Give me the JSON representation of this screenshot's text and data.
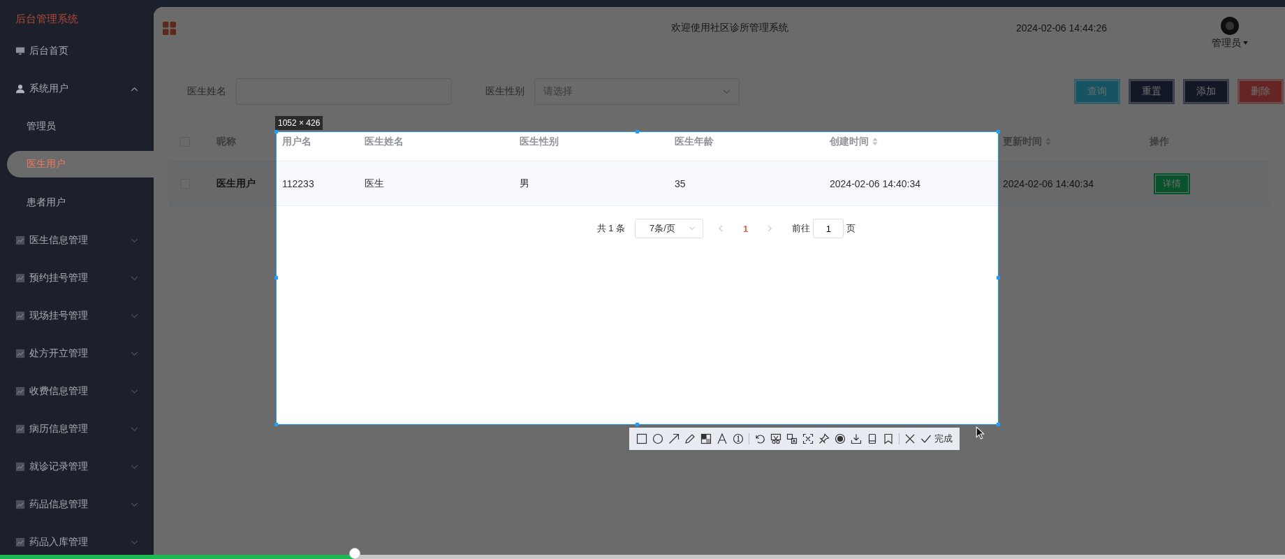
{
  "sidebar": {
    "title": "后台管理系统",
    "items": [
      {
        "label": "后台首页",
        "kind": "monitor",
        "selected": false
      },
      {
        "label": "系统用户",
        "kind": "user",
        "selected": false,
        "expanded": true,
        "children": [
          {
            "label": "管理员",
            "selected": false
          },
          {
            "label": "医生用户",
            "selected": true
          },
          {
            "label": "患者用户",
            "selected": false
          }
        ]
      },
      {
        "label": "医生信息管理",
        "kind": "chart",
        "selected": false,
        "expanded": false
      },
      {
        "label": "预约挂号管理",
        "kind": "chart",
        "selected": false,
        "expanded": false
      },
      {
        "label": "现场挂号管理",
        "kind": "chart",
        "selected": false,
        "expanded": false
      },
      {
        "label": "处方开立管理",
        "kind": "chart",
        "selected": false,
        "expanded": false
      },
      {
        "label": "收费信息管理",
        "kind": "chart",
        "selected": false,
        "expanded": false
      },
      {
        "label": "病历信息管理",
        "kind": "chart",
        "selected": false,
        "expanded": false
      },
      {
        "label": "就诊记录管理",
        "kind": "chart",
        "selected": false,
        "expanded": false
      },
      {
        "label": "药品信息管理",
        "kind": "chart",
        "selected": false,
        "expanded": false
      },
      {
        "label": "药品入库管理",
        "kind": "chart",
        "selected": false,
        "expanded": false
      }
    ]
  },
  "header": {
    "title": "欢迎使用社区诊所管理系统",
    "datetime": "2024-02-06 14:44:26",
    "user": "管理员"
  },
  "search": {
    "fields": [
      {
        "label": "医生姓名",
        "kind": "text"
      },
      {
        "label": "医生性别",
        "kind": "select",
        "placeholder": "请选择"
      }
    ],
    "buttons": [
      {
        "label": "查询",
        "kind": "query"
      },
      {
        "label": "重置",
        "kind": "reset"
      },
      {
        "label": "添加",
        "kind": "add"
      },
      {
        "label": "删除",
        "kind": "delete"
      }
    ]
  },
  "table": {
    "all_checked": false,
    "columns": [
      {
        "label": "昵称",
        "sortable": false
      },
      {
        "label": "用户名",
        "sortable": false
      },
      {
        "label": "医生姓名",
        "sortable": false
      },
      {
        "label": "医生性别",
        "sortable": false
      },
      {
        "label": "医生年龄",
        "sortable": false
      },
      {
        "label": "创建时间",
        "sortable": true
      },
      {
        "label": "更新时间",
        "sortable": true
      },
      {
        "label": "操作",
        "sortable": false
      }
    ],
    "rows": [
      {
        "checked": false,
        "cells": [
          "医生用户",
          "112233",
          "医生",
          "男",
          "35",
          "2024-02-06 14:40:34",
          "2024-02-06 14:40:34"
        ],
        "action": "详情"
      }
    ]
  },
  "pagination": {
    "total": "共 1 条",
    "page_size": "7条/页",
    "pages": [
      {
        "label": "1",
        "selected": true
      }
    ],
    "goto_label": "前往",
    "goto_value": "1",
    "goto_suffix": "页"
  },
  "capture": {
    "size_label": "1052 × 426",
    "tools": [
      {
        "kind": "rect"
      },
      {
        "kind": "circle"
      },
      {
        "kind": "arrow"
      },
      {
        "kind": "pencil"
      },
      {
        "kind": "mosaic"
      },
      {
        "kind": "text"
      },
      {
        "kind": "number"
      },
      {
        "kind": "sep"
      },
      {
        "kind": "undo"
      },
      {
        "kind": "cut"
      },
      {
        "kind": "translate"
      },
      {
        "kind": "scan"
      },
      {
        "kind": "pin"
      },
      {
        "kind": "record"
      },
      {
        "kind": "download"
      },
      {
        "kind": "phone"
      },
      {
        "kind": "bookmark"
      },
      {
        "kind": "sep"
      },
      {
        "kind": "close"
      },
      {
        "kind": "check"
      }
    ],
    "done_label": "完成"
  },
  "player": {
    "level": 0.276
  }
}
